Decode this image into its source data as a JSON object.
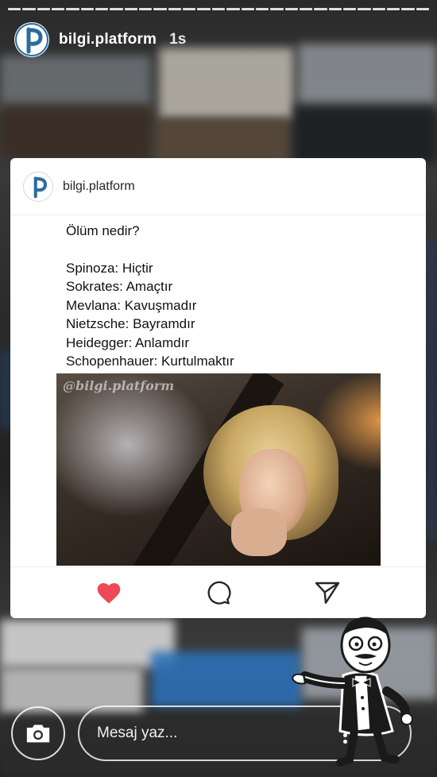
{
  "story": {
    "username": "bilgi.platform",
    "time": "1s",
    "segments": 29
  },
  "post": {
    "username": "bilgi.platform",
    "question": "Ölüm nedir?",
    "lines": [
      "Spinoza: Hiçtir",
      "Sokrates: Amaçtır",
      "Mevlana: Kavuşmadır",
      "Nietzsche: Bayramdır",
      "Heidegger: Anlamdır",
      "Schopenhauer: Kurtulmaktır"
    ],
    "image_watermark": "@bilgi.platform",
    "actions": {
      "like_icon": "heart-filled-icon",
      "comment_icon": "comment-icon",
      "share_icon": "send-icon",
      "like_color": "#ed4956"
    }
  },
  "footer": {
    "camera_icon": "camera-icon",
    "message_placeholder": "Mesaj yaz..."
  }
}
